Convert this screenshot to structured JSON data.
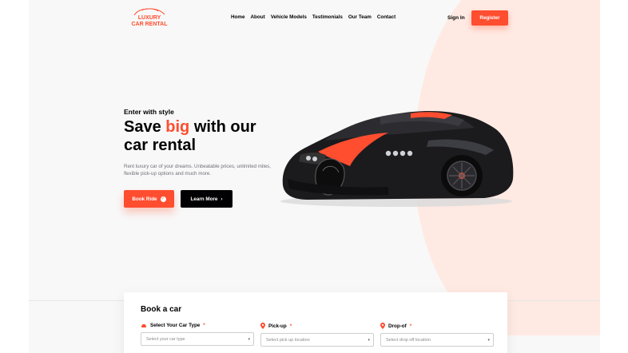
{
  "brand": {
    "line1": "LUXURY",
    "line2": "CAR RENTAL",
    "accent_color": "#ff4d30"
  },
  "nav": {
    "items": [
      {
        "label": "Home"
      },
      {
        "label": "About"
      },
      {
        "label": "Vehicle Models"
      },
      {
        "label": "Testimonials"
      },
      {
        "label": "Our Team"
      },
      {
        "label": "Contact"
      }
    ],
    "sign_in": "Sign In",
    "register": "Register"
  },
  "hero": {
    "tagline": "Enter with style",
    "headline_pre": "Save ",
    "headline_accent": "big",
    "headline_post": " with our car rental",
    "description": "Rent luxury car of your dreams. Unbeatable prices, unlimited miles, flexible pick-up options and much more.",
    "book_button": "Book Ride",
    "learn_button": "Learn More"
  },
  "booking": {
    "title": "Book a car",
    "fields": [
      {
        "label": "Select Your Car Type",
        "required": "*",
        "placeholder": "Select your car type",
        "icon": "car-icon"
      },
      {
        "label": "Pick-up",
        "required": "*",
        "placeholder": "Select pick up location",
        "icon": "location-pin-icon"
      },
      {
        "label": "Drop-of",
        "required": "*",
        "placeholder": "Select drop off location",
        "icon": "location-pin-icon"
      }
    ]
  }
}
